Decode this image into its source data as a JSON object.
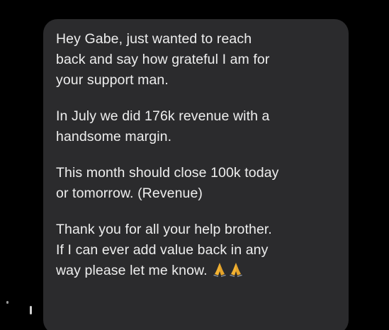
{
  "message": {
    "paragraphs": [
      {
        "lines": [
          "Hey Gabe, just wanted to reach",
          "back and say how grateful I am for",
          "your support man."
        ]
      },
      {
        "lines": [
          "In July we did 176k revenue with a",
          "handsome margin."
        ]
      },
      {
        "lines": [
          "This month should close 100k today",
          "or tomorrow. (Revenue)"
        ]
      },
      {
        "lines": [
          "Thank you for all your help brother.",
          "If I can ever add value back in any",
          "way please let me know."
        ]
      }
    ],
    "trailing_emoji": [
      "folded-hands-icon",
      "folded-hands-icon"
    ]
  },
  "colors": {
    "background": "#000000",
    "bubble": "#2b2b2d",
    "text": "#eeeeee",
    "emoji": "#f2b233"
  }
}
